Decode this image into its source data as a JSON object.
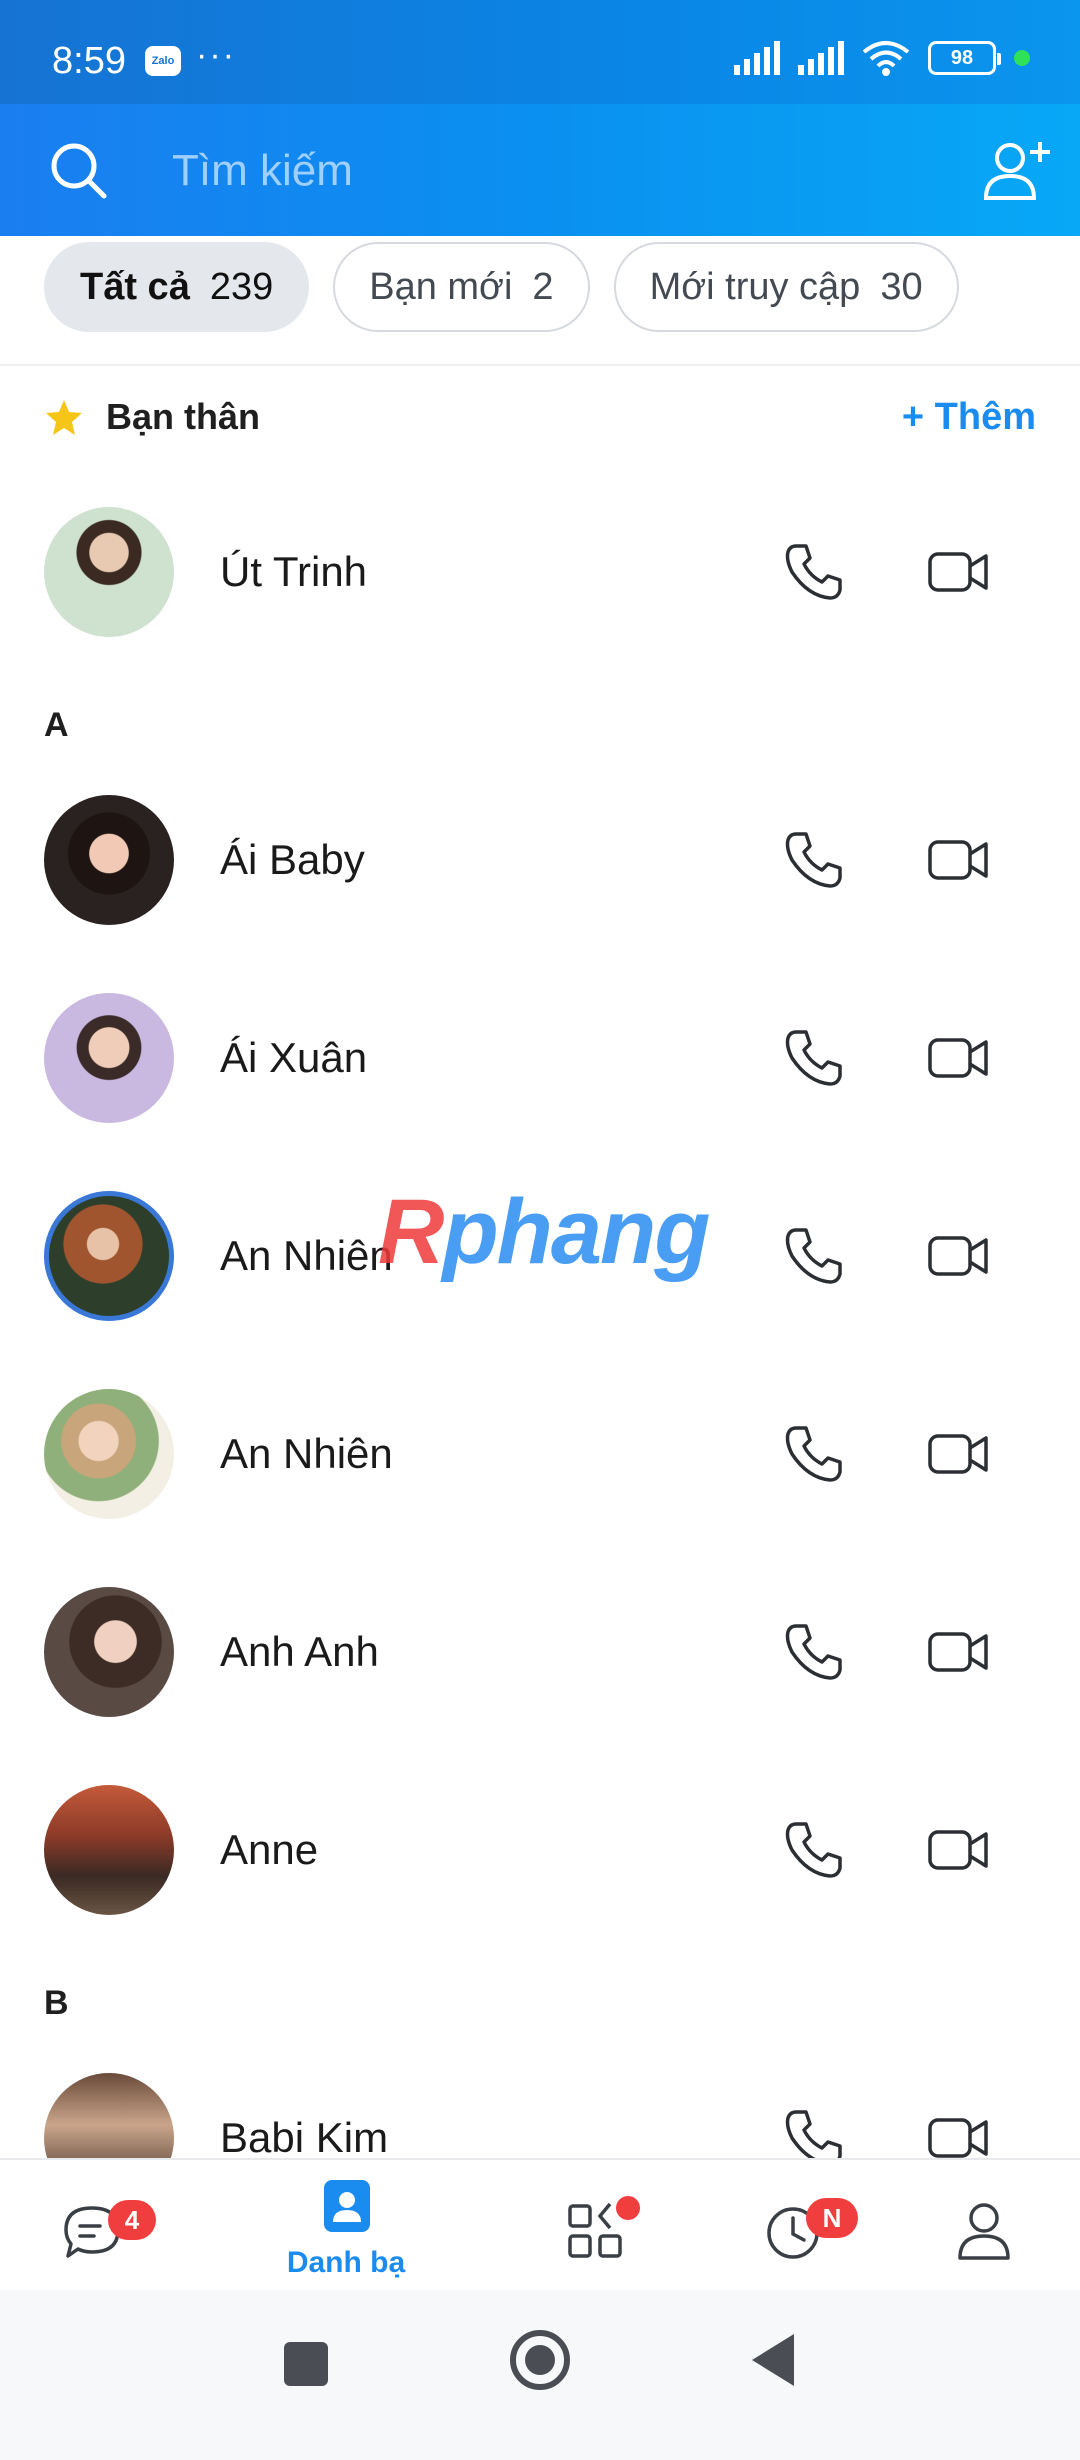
{
  "status_bar": {
    "time": "8:59",
    "app_icon_label": "Zalo",
    "more": "···",
    "battery": "98"
  },
  "search": {
    "placeholder": "Tìm kiếm"
  },
  "filters": [
    {
      "label": "Tất cả",
      "count": "239",
      "active": true
    },
    {
      "label": "Bạn mới",
      "count": "2",
      "active": false
    },
    {
      "label": "Mới truy cập",
      "count": "30",
      "active": false
    }
  ],
  "close_friends": {
    "title": "Bạn thân",
    "add_label": "+ Thêm"
  },
  "contacts": {
    "favorite": [
      {
        "name": "Út Trinh"
      }
    ],
    "section_a": {
      "letter": "A",
      "items": [
        {
          "name": "Ái Baby"
        },
        {
          "name": "Ái Xuân"
        },
        {
          "name": "An Nhiên"
        },
        {
          "name": "An Nhiên"
        },
        {
          "name": "Anh Anh"
        },
        {
          "name": "Anne"
        }
      ]
    },
    "section_b": {
      "letter": "B",
      "items": [
        {
          "name": "Babi Kim"
        }
      ]
    }
  },
  "watermark": {
    "part1": "R",
    "part2": "phang"
  },
  "bottom_nav": {
    "messages_badge": "4",
    "contacts_label": "Danh bạ",
    "timeline_badge": "N"
  },
  "colors": {
    "accent": "#1a8cf0",
    "badge": "#f03e3e",
    "header_start": "#1a7ef0",
    "header_end": "#08a8f6"
  }
}
